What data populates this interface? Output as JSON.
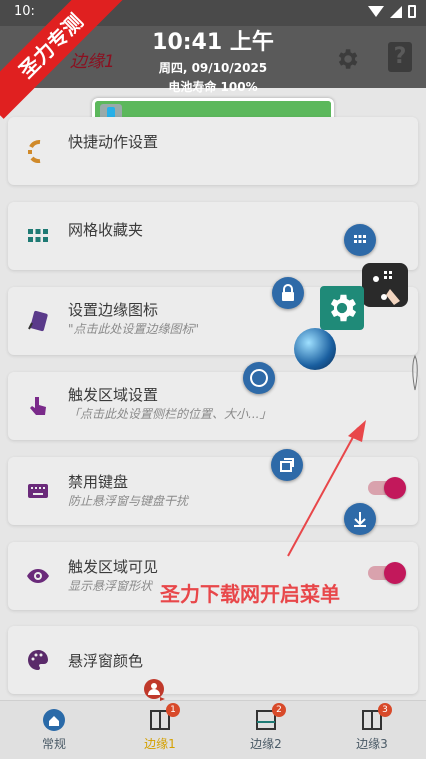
{
  "status_bar": {
    "time": "10:"
  },
  "clock": {
    "time": "10:41 上午",
    "date": "周四, 09/10/2025",
    "battery": "电池寿命 100%"
  },
  "toolbar": {
    "title": "边缘1"
  },
  "battery_bar": {
    "level": 1.0,
    "color": "#5cb85c"
  },
  "cards": [
    {
      "title": "快捷动作设置",
      "subtitle": ""
    },
    {
      "title": "网格收藏夹",
      "subtitle": ""
    },
    {
      "title": "设置边缘图标",
      "subtitle": "\"点击此处设置边缘图标\""
    },
    {
      "title": "触发区域设置",
      "subtitle": "「点击此处设置侧栏的位置、大小...」"
    },
    {
      "title": "禁用键盘",
      "subtitle": "防止悬浮窗与键盘干扰"
    },
    {
      "title": "触发区域可见",
      "subtitle": "显示悬浮窗形状"
    },
    {
      "title": "悬浮窗颜色",
      "subtitle": ""
    }
  ],
  "toggles": {
    "disable_keyboard": true,
    "trigger_visible": true
  },
  "bottom_nav": [
    {
      "label": "常规",
      "badge": ""
    },
    {
      "label": "边缘1",
      "badge": "1"
    },
    {
      "label": "边缘2",
      "badge": "2"
    },
    {
      "label": "边缘3",
      "badge": "3"
    }
  ],
  "overlay": {
    "watermark": "圣力专测",
    "caption": "圣力下载网开启菜单"
  },
  "colors": {
    "accent": "#c2185b",
    "active_tab": "#d4a000",
    "fab": "#2e6aa8",
    "caption": "#e8474a"
  }
}
